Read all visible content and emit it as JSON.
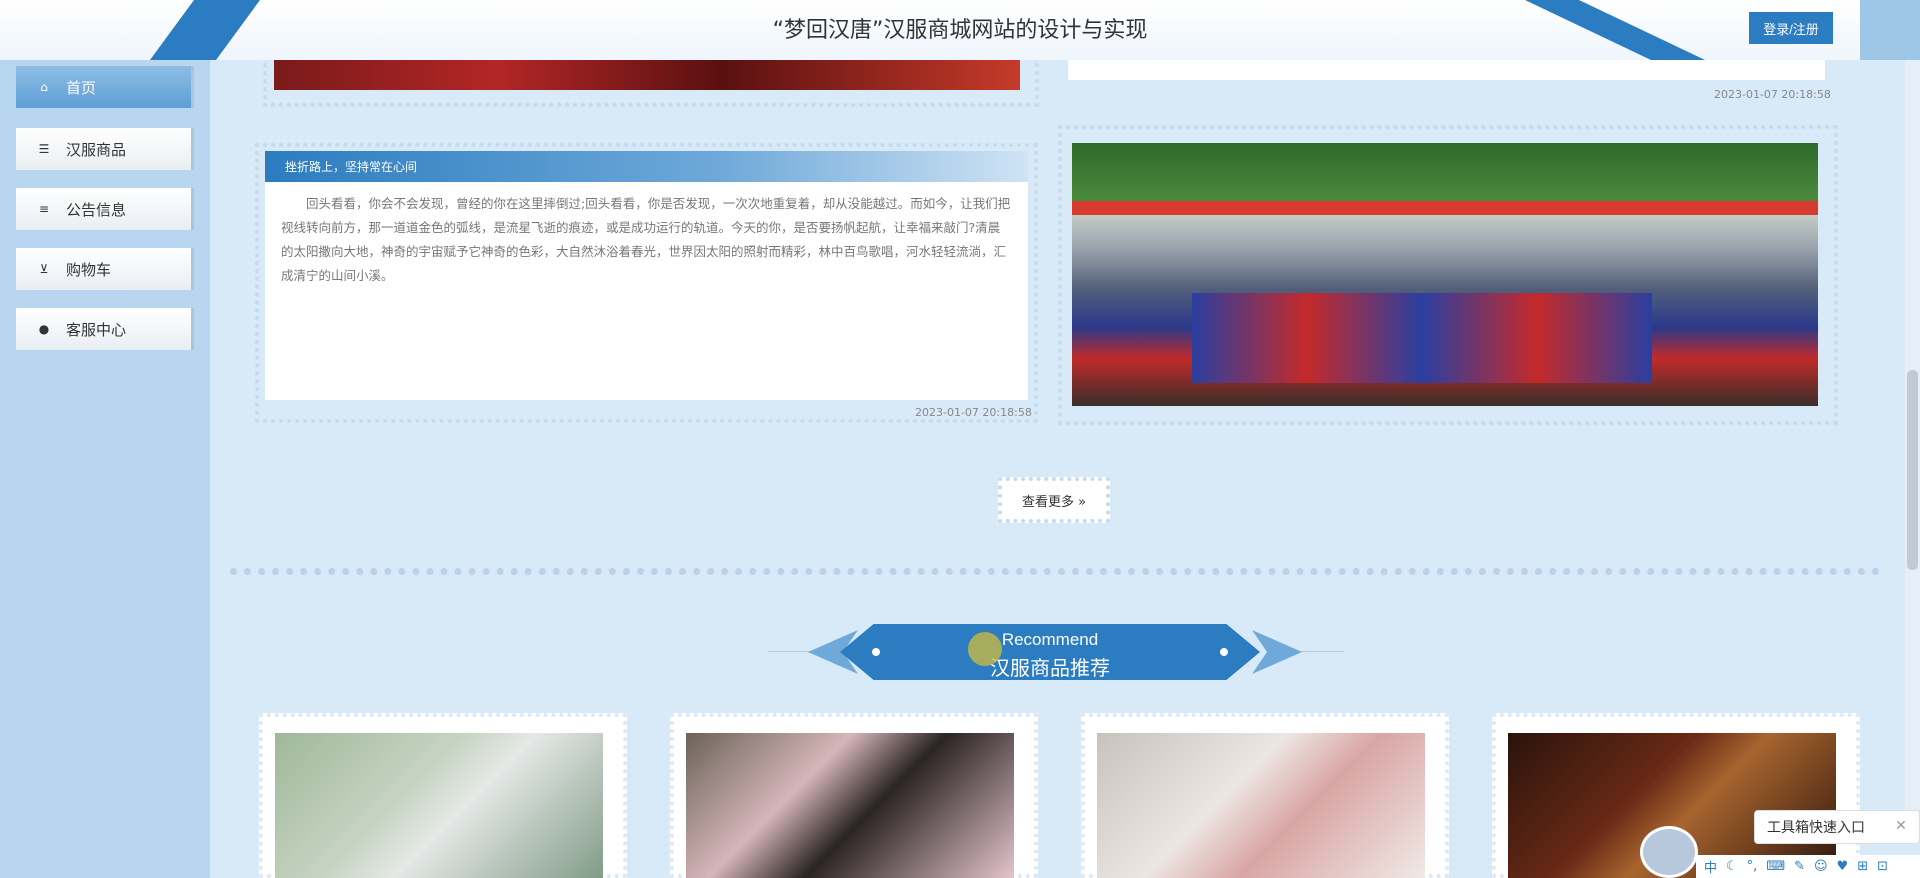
{
  "header": {
    "title": "“梦回汉唐”汉服商城网站的设计与实现",
    "login_label": "登录/注册"
  },
  "sidebar": {
    "items": [
      {
        "label": "首页",
        "icon": "home-icon",
        "active": true
      },
      {
        "label": "汉服商品",
        "icon": "layers-icon",
        "active": false
      },
      {
        "label": "公告信息",
        "icon": "sliders-icon",
        "active": false
      },
      {
        "label": "购物车",
        "icon": "cart-icon",
        "active": false
      },
      {
        "label": "客服中心",
        "icon": "chat-icon",
        "active": false
      }
    ]
  },
  "news": {
    "top_right_date": "2023-01-07 20:18:58",
    "card_title": "挫折路上，坚持常在心间",
    "card_body": "回头看看，你会不会发现，曾经的你在这里摔倒过;回头看看，你是否发现，一次次地重复着，却从没能越过。而如今，让我们把视线转向前方，那一道道金色的弧线，是流星飞逝的痕迹，或是成功运行的轨道。今天的你，是否要扬帆起航，让幸福来敲门?清晨的太阳撒向大地，神奇的宇宙赋予它神奇的色彩，大自然沐浴着春光，世界因太阳的照射而精彩，林中百鸟歌唱，河水轻轻流淌，汇成清宁的山间小溪。",
    "card_date": "2023-01-07 20:18:58",
    "more_label": "查看更多 »"
  },
  "recommend": {
    "en": "Recommend",
    "cn": "汉服商品推荐"
  },
  "toolbox": {
    "label": "工具箱快速入口",
    "close": "✕",
    "ime": [
      "中",
      "☾",
      "°,",
      "⌨",
      "✎",
      "☺",
      "♥",
      "⊞",
      "⊡"
    ]
  },
  "colors": {
    "accent": "#2b7cc0",
    "sidebar_bg": "#b8d6ef",
    "main_bg": "#d8e9f8"
  }
}
